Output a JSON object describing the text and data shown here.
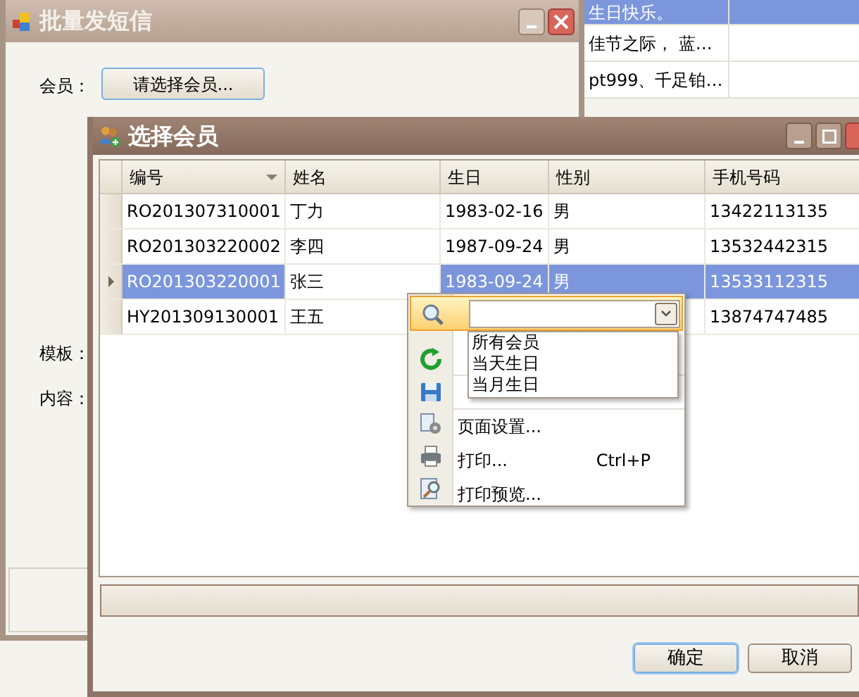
{
  "background_grid": {
    "rows": [
      {
        "text": "生日快乐。",
        "selected": true
      },
      {
        "text": "佳节之际， 蓝…",
        "selected": false
      },
      {
        "text": "pt999、千足铂…",
        "selected": false
      }
    ]
  },
  "batch_window": {
    "title": "批量发短信",
    "member_label": "会员：",
    "member_button": "请选择会员...",
    "template_label": "模板：",
    "content_label": "内容："
  },
  "dialog": {
    "title": "选择会员",
    "table": {
      "columns": [
        {
          "label": "编号",
          "sorted": true
        },
        {
          "label": "姓名",
          "sorted": false
        },
        {
          "label": "生日",
          "sorted": false
        },
        {
          "label": "性别",
          "sorted": false
        },
        {
          "label": "手机号码",
          "sorted": false
        }
      ],
      "rows": [
        {
          "cells": [
            "RO201307310001",
            "丁力",
            "1983-02-16",
            "男",
            "13422113135"
          ],
          "selected": false
        },
        {
          "cells": [
            "RO201303220002",
            "李四",
            "1987-09-24",
            "男",
            "13532442315"
          ],
          "selected": false
        },
        {
          "cells": [
            "RO201303220001",
            "张三",
            "1983-09-24",
            "男",
            "13533112315"
          ],
          "selected": true
        },
        {
          "cells": [
            "HY201309130001",
            "王五",
            null,
            null,
            "13874747485"
          ],
          "selected": false
        }
      ]
    },
    "buttons": [
      {
        "label": "确定",
        "default": true
      },
      {
        "label": "取消",
        "default": false
      }
    ]
  },
  "context_menu": {
    "filter_options": [
      "所有会员",
      "当天生日",
      "当月生日"
    ],
    "items": [
      {
        "kind": "covered"
      },
      {
        "kind": "covered"
      },
      {
        "kind": "item",
        "label": "页面设置..."
      },
      {
        "kind": "item",
        "label": "打印...",
        "shortcut": "Ctrl+P"
      },
      {
        "kind": "item",
        "label": "打印预览..."
      }
    ]
  }
}
